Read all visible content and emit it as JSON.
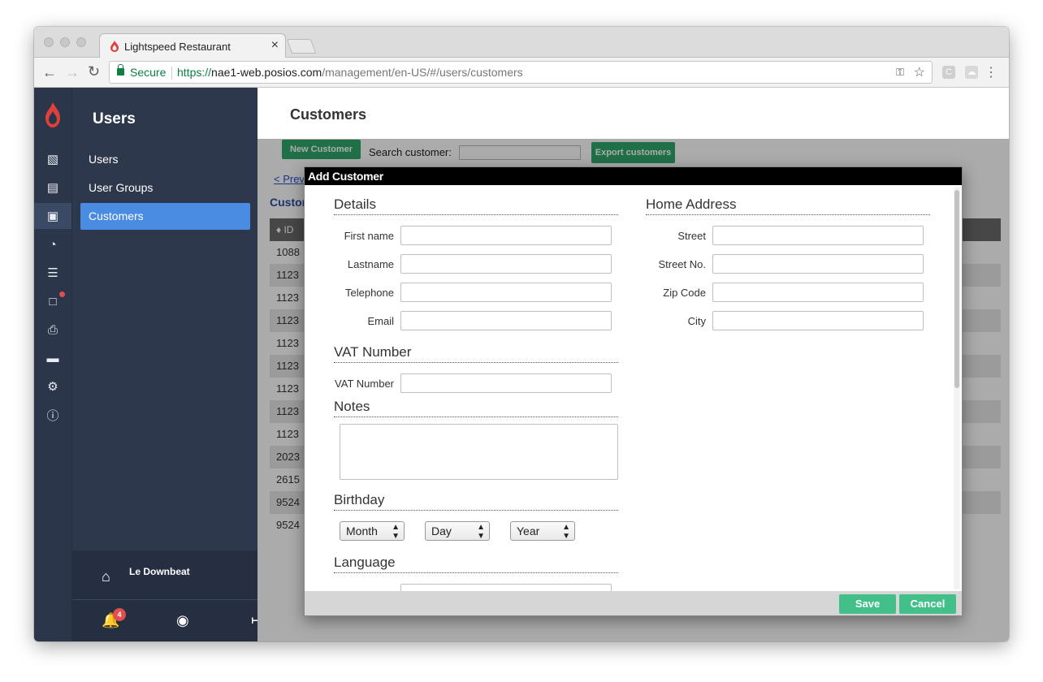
{
  "browser": {
    "tab_title": "Lightspeed Restaurant",
    "tab_close": "×",
    "secure_label": "Secure",
    "url_scheme": "https://",
    "url_host": "nae1-web.posios.com",
    "url_path": "/management/en-US/#/users/customers",
    "ext1": "C"
  },
  "sidebar": {
    "heading": "Users",
    "items": [
      {
        "label": "Users"
      },
      {
        "label": "User Groups"
      },
      {
        "label": "Customers"
      }
    ],
    "venue_name": "Le Downbeat",
    "notification_count": "4"
  },
  "page": {
    "title": "Customers",
    "new_customer_label": "New Customer",
    "search_label": "Search customer:",
    "export_label": "Export customers",
    "prev_link": "< Prev",
    "table_title": "Custom",
    "table_header_id": "ID",
    "rows": [
      "1088",
      "1123",
      "1123",
      "1123",
      "1123",
      "1123",
      "1123",
      "1123",
      "1123",
      "2023",
      "2615",
      "9524",
      "9524"
    ]
  },
  "modal": {
    "title": "Add Customer",
    "details_title": "Details",
    "details_fields": [
      {
        "label": "First name"
      },
      {
        "label": "Lastname"
      },
      {
        "label": "Telephone"
      },
      {
        "label": "Email"
      }
    ],
    "home_title": "Home Address",
    "home_fields": [
      {
        "label": "Street"
      },
      {
        "label": "Street No."
      },
      {
        "label": "Zip Code"
      },
      {
        "label": "City"
      }
    ],
    "vat_title": "VAT Number",
    "vat_label": "VAT Number",
    "notes_title": "Notes",
    "birthday_title": "Birthday",
    "birthday_selects": {
      "month": "Month",
      "day": "Day",
      "year": "Year"
    },
    "language_title": "Language",
    "save_label": "Save",
    "cancel_label": "Cancel"
  },
  "colors": {
    "accent_blue": "#4a8ce2",
    "green_button": "#31a86b",
    "sidebar_bg": "#2e384d",
    "rail_bg": "#2c364a"
  }
}
